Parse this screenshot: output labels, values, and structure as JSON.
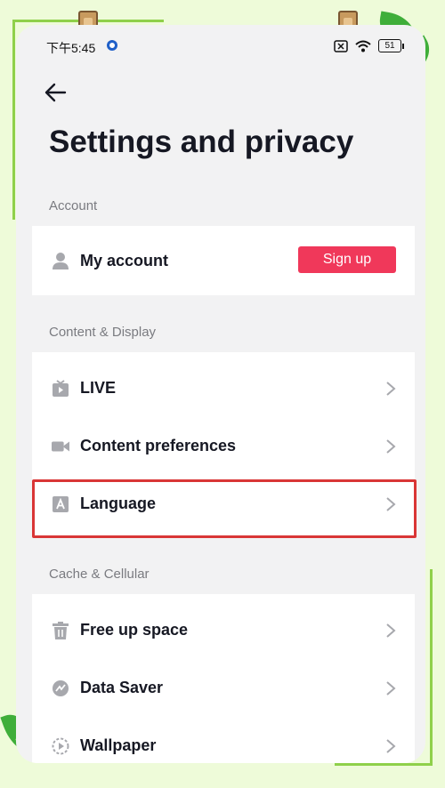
{
  "status_bar": {
    "time": "下午5:45",
    "battery": "51"
  },
  "page": {
    "title": "Settings and privacy"
  },
  "sections": {
    "account": {
      "label": "Account",
      "my_account": "My account",
      "signup": "Sign up"
    },
    "content_display": {
      "label": "Content & Display",
      "items": [
        "LIVE",
        "Content preferences",
        "Language"
      ]
    },
    "cache_cellular": {
      "label": "Cache & Cellular",
      "items": [
        "Free up space",
        "Data Saver",
        "Wallpaper"
      ]
    }
  },
  "colors": {
    "accent": "#f0385a",
    "highlight": "#d93636",
    "background": "#eefbd9"
  }
}
